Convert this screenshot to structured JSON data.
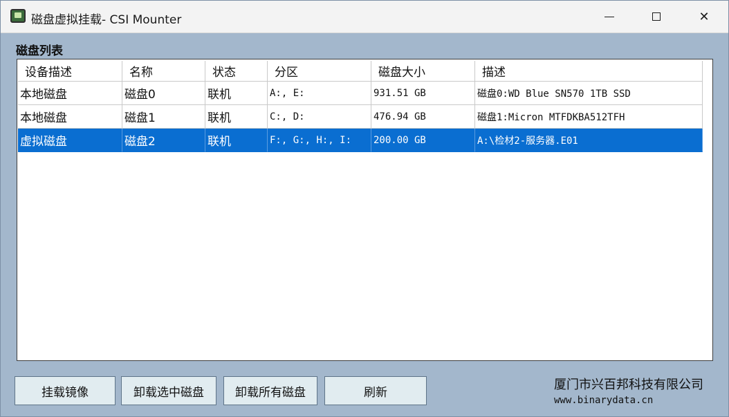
{
  "window": {
    "title": "磁盘虚拟挂载- CSI Mounter",
    "icon": "disk-app-icon"
  },
  "section": {
    "label": "磁盘列表"
  },
  "table": {
    "columns": [
      "设备描述",
      "名称",
      "状态",
      "分区",
      "磁盘大小",
      "描述"
    ],
    "rows": [
      {
        "device": "本地磁盘",
        "name": "磁盘0",
        "status": "联机",
        "partition": "A:, E:",
        "size": "931.51 GB",
        "desc": "磁盘0:WD Blue SN570 1TB SSD"
      },
      {
        "device": "本地磁盘",
        "name": "磁盘1",
        "status": "联机",
        "partition": "C:, D:",
        "size": "476.94 GB",
        "desc": "磁盘1:Micron MTFDKBA512TFH"
      },
      {
        "device": "虚拟磁盘",
        "name": "磁盘2",
        "status": "联机",
        "partition": "F:, G:, H:, I:",
        "size": "200.00 GB",
        "desc": "A:\\检材2-服务器.E01"
      }
    ],
    "selected_row": 2,
    "selection_color": "#0a6ed1"
  },
  "buttons": {
    "mount": "挂载镜像",
    "unmount_selected": "卸载选中磁盘",
    "unmount_all": "卸载所有磁盘",
    "refresh": "刷新"
  },
  "footer": {
    "company": "厦门市兴百邦科技有限公司",
    "website": "www.binarydata.cn"
  }
}
